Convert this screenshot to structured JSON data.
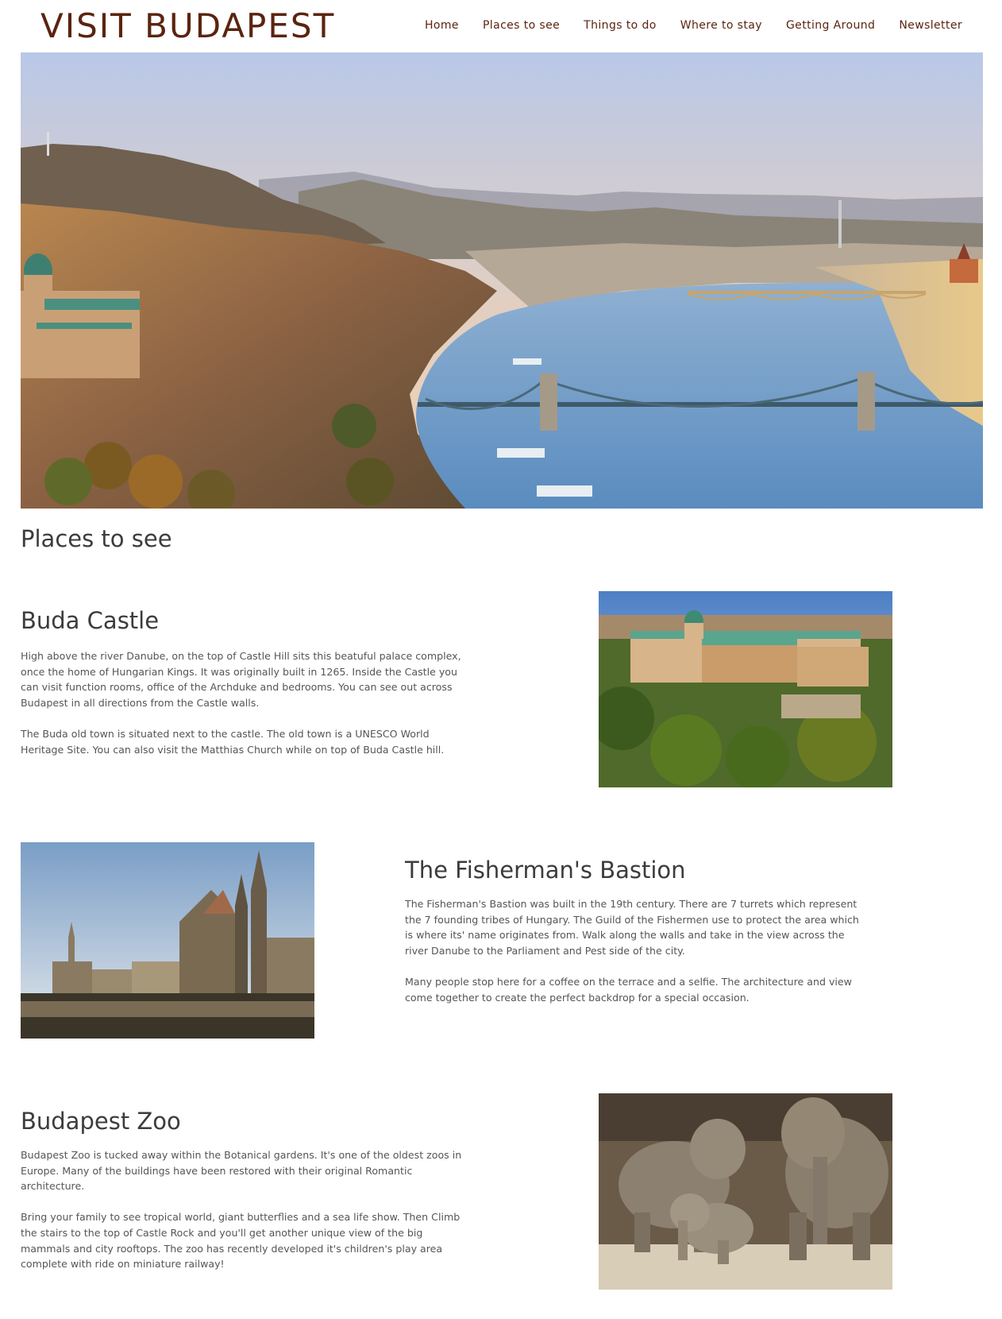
{
  "site": {
    "logo": "VISIT BUDAPEST",
    "nav": [
      "Home",
      "Places to see",
      "Things to do",
      "Where to stay",
      "Getting Around",
      "Newsletter"
    ]
  },
  "hero": {
    "image": "budapest-panorama-danube-chain-bridge"
  },
  "main": {
    "title": "Places to see",
    "places": [
      {
        "title": "Buda Castle",
        "paragraphs": [
          "High above the river Danube, on the top of Castle Hill sits this beatuful palace complex, once the home of Hungarian Kings. It was originally built in 1265. Inside the Castle you can visit function rooms, office of the Archduke and bedrooms. You can see out across Budapest in all directions from the Castle walls.",
          "The Buda old town is situated next to the castle. The old town is a UNESCO World Heritage Site. You can also visit the Matthias Church while on top of Buda Castle hill."
        ],
        "image": "buda-castle-aerial-photo"
      },
      {
        "title": "The Fisherman's Bastion",
        "paragraphs": [
          "The Fisherman's Bastion was built in the 19th century. There are 7 turrets which represent the 7 founding tribes of Hungary. The Guild of the Fishermen use to protect the area which is where its' name originates from. Walk along the walls and take in the view across the river Danube to the Parliament and Pest side of the city.",
          "Many people stop here for a coffee on the terrace and a selfie. The architecture and view come together to create the perfect backdrop for a special occasion."
        ],
        "image": "fishermans-bastion-photo"
      },
      {
        "title": "Budapest Zoo",
        "paragraphs": [
          "Budapest Zoo is tucked away within the Botanical gardens. It's one of the oldest zoos in Europe. Many of the buildings have been restored with their original Romantic architecture.",
          "Bring your family to see tropical world, giant butterflies and a sea life show. Then Climb the stairs to the top of Castle Rock and you'll get another unique view of the big mammals and city rooftops. The zoo has recently developed it's children's play area complete with ride on miniature railway!"
        ],
        "image": "elephants-zoo-photo"
      }
    ]
  },
  "colors": {
    "brand": "#5a2410",
    "heading": "#3c3c3c",
    "body_text": "#555555",
    "background": "#ffffff"
  }
}
